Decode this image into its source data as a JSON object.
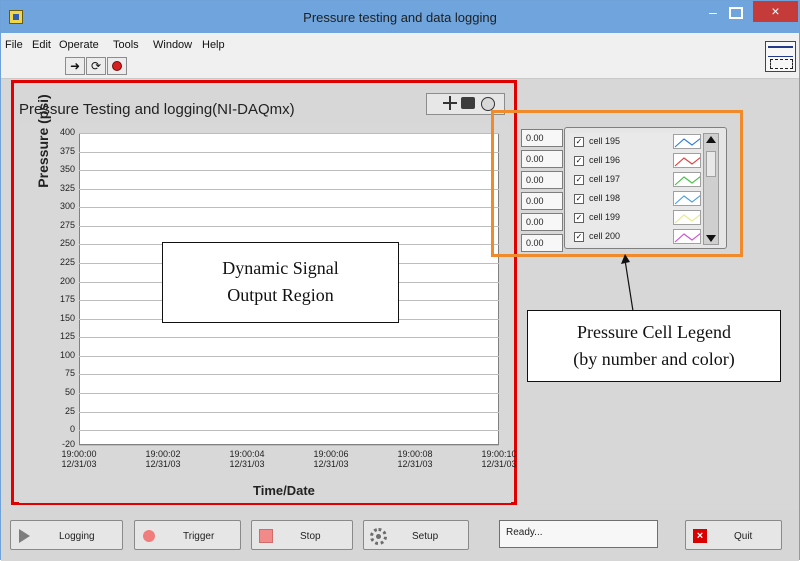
{
  "window": {
    "title": "Pressure testing and data logging",
    "close_label": "×"
  },
  "menu": {
    "items": [
      "File",
      "Edit",
      "Operate",
      "Tools",
      "Window",
      "Help"
    ]
  },
  "graph": {
    "title": "Pressure Testing and logging(NI-DAQmx)",
    "ylabel": "Pressure (psi)",
    "xlabel": "Time/Date",
    "yticks": [
      "400",
      "375",
      "350",
      "325",
      "300",
      "275",
      "250",
      "225",
      "200",
      "175",
      "150",
      "125",
      "100",
      "75",
      "50",
      "25",
      "0",
      "-20"
    ],
    "xticks": [
      {
        "time": "19:00:00",
        "date": "12/31/03"
      },
      {
        "time": "19:00:02",
        "date": "12/31/03"
      },
      {
        "time": "19:00:04",
        "date": "12/31/03"
      },
      {
        "time": "19:00:06",
        "date": "12/31/03"
      },
      {
        "time": "19:00:08",
        "date": "12/31/03"
      },
      {
        "time": "19:00:10",
        "date": "12/31/03"
      }
    ]
  },
  "legend": {
    "values": [
      "0.00",
      "0.00",
      "0.00",
      "0.00",
      "0.00",
      "0.00"
    ],
    "items": [
      {
        "label": "cell 195",
        "checked": true,
        "color": "#2f7bd8"
      },
      {
        "label": "cell 196",
        "checked": true,
        "color": "#e43b3b"
      },
      {
        "label": "cell 197",
        "checked": true,
        "color": "#41c041"
      },
      {
        "label": "cell 198",
        "checked": true,
        "color": "#4c9de0"
      },
      {
        "label": "cell 199",
        "checked": true,
        "color": "#e8e88d"
      },
      {
        "label": "cell 200",
        "checked": true,
        "color": "#cf4cd9"
      }
    ]
  },
  "annotations": {
    "signal_region_line1": "Dynamic Signal",
    "signal_region_line2": "Output Region",
    "legend_line1": "Pressure Cell Legend",
    "legend_line2": "(by number and color)"
  },
  "buttons": {
    "logging": "Logging",
    "trigger": "Trigger",
    "stop": "Stop",
    "setup": "Setup",
    "quit": "Quit"
  },
  "status": {
    "text": "Ready..."
  },
  "chart_data": {
    "type": "line",
    "title": "Pressure Testing and logging(NI-DAQmx)",
    "xlabel": "Time/Date",
    "ylabel": "Pressure (psi)",
    "ylim": [
      -20,
      400
    ],
    "x": [
      "19:00:00 12/31/03",
      "19:00:02 12/31/03",
      "19:00:04 12/31/03",
      "19:00:06 12/31/03",
      "19:00:08 12/31/03",
      "19:00:10 12/31/03"
    ],
    "series": [
      {
        "name": "cell 195",
        "values": []
      },
      {
        "name": "cell 196",
        "values": []
      },
      {
        "name": "cell 197",
        "values": []
      },
      {
        "name": "cell 198",
        "values": []
      },
      {
        "name": "cell 199",
        "values": []
      },
      {
        "name": "cell 200",
        "values": []
      }
    ],
    "grid": true,
    "legend": "right"
  }
}
